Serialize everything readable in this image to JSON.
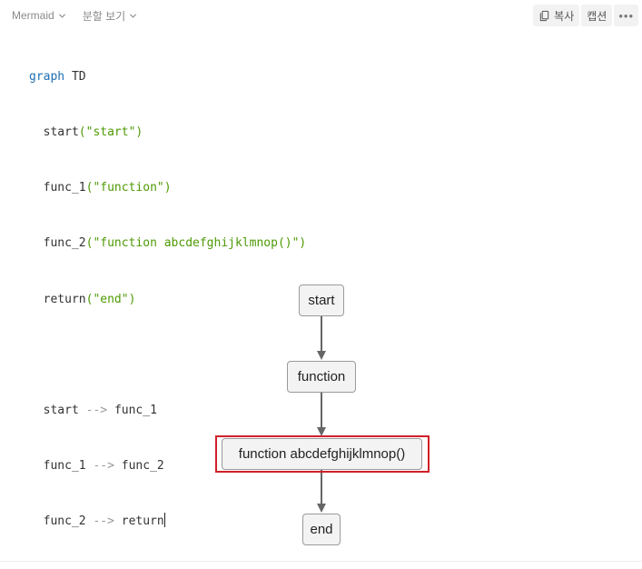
{
  "toolbar": {
    "language_label": "Mermaid",
    "view_label": "분할 보기",
    "copy_label": "복사",
    "caption_label": "캡션",
    "more_label": "•••",
    "icons": {
      "language_dropdown": "chevron-down-icon",
      "view_dropdown": "chevron-down-icon",
      "copy": "copy-icon",
      "more": "more-horizontal-icon"
    }
  },
  "code": {
    "line1_kw": "graph",
    "line1_rest": " TD",
    "line2_id": "start",
    "line2_str": "(\"start\")",
    "line3_id": "func_1",
    "line3_str": "(\"function\")",
    "line4_id": "func_2",
    "line4_str": "(\"function abcdefghijklmnop()\")",
    "line5_id": "return",
    "line5_str": "(\"end\")",
    "edge1_from": "start",
    "edge1_arrow": " --> ",
    "edge1_to": "func_1",
    "edge2_from": "func_1",
    "edge2_arrow": " --> ",
    "edge2_to": "func_2",
    "edge3_from": "func_2",
    "edge3_arrow": " --> ",
    "edge3_to": "return"
  },
  "diagram": {
    "nodes": {
      "start": "start",
      "func_1": "function",
      "func_2": "function abcdefghijklmnop()",
      "return": "end"
    },
    "highlighted_node": "func_2",
    "colors": {
      "node_fill": "#f3f3f3",
      "node_border": "#9a9a9a",
      "edge": "#666666",
      "highlight": "#d0202a"
    }
  }
}
